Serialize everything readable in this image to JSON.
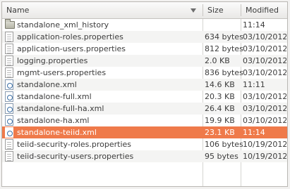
{
  "columns": {
    "name": "Name",
    "size": "Size",
    "modified": "Modified"
  },
  "files": [
    {
      "name": "standalone_xml_history",
      "size": "",
      "modified": "11:14",
      "icon": "folder-icon"
    },
    {
      "name": "application-roles.properties",
      "size": "634 bytes",
      "modified": "03/10/2012",
      "icon": "text-file-icon"
    },
    {
      "name": "application-users.properties",
      "size": "812 bytes",
      "modified": "03/10/2012",
      "icon": "text-file-icon"
    },
    {
      "name": "logging.properties",
      "size": "2.0 KB",
      "modified": "03/10/2012",
      "icon": "text-file-icon"
    },
    {
      "name": "mgmt-users.properties",
      "size": "836 bytes",
      "modified": "03/10/2012",
      "icon": "text-file-icon"
    },
    {
      "name": "standalone.xml",
      "size": "14.6 KB",
      "modified": "11:11",
      "icon": "xml-file-icon"
    },
    {
      "name": "standalone-full.xml",
      "size": "20.3 KB",
      "modified": "03/10/2012",
      "icon": "xml-file-icon"
    },
    {
      "name": "standalone-full-ha.xml",
      "size": "26.4 KB",
      "modified": "03/10/2012",
      "icon": "xml-file-icon"
    },
    {
      "name": "standalone-ha.xml",
      "size": "19.9 KB",
      "modified": "03/10/2012",
      "icon": "xml-file-icon"
    },
    {
      "name": "standalone-teiid.xml",
      "size": "23.1 KB",
      "modified": "11:14",
      "icon": "xml-file-icon",
      "selected": true
    },
    {
      "name": "teiid-security-roles.properties",
      "size": "106 bytes",
      "modified": "10/19/2012",
      "icon": "text-file-icon"
    },
    {
      "name": "teiid-security-users.properties",
      "size": "95 bytes",
      "modified": "10/19/2012",
      "icon": "text-file-icon"
    }
  ],
  "colors": {
    "selection": "#ef7a4a"
  }
}
